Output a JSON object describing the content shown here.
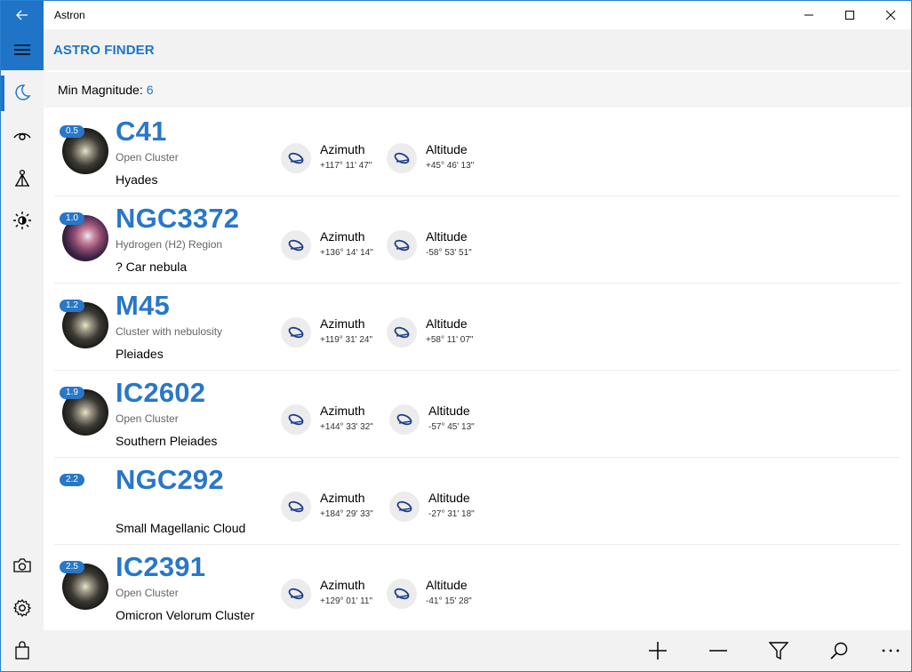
{
  "window": {
    "title": "Astron"
  },
  "header": {
    "title": "ASTRO FINDER"
  },
  "filter": {
    "label": "Min Magnitude:",
    "value": "6"
  },
  "objects": [
    {
      "magnitude": "0.5",
      "designation": "C41",
      "type": "Open Cluster",
      "common_name": "Hyades",
      "thumb": "cluster",
      "azimuth_label": "Azimuth",
      "azimuth": "+117° 11' 47\"",
      "altitude_label": "Altitude",
      "altitude": "+45° 46' 13\""
    },
    {
      "magnitude": "1.0",
      "designation": "NGC3372",
      "type": "Hydrogen (H2) Region",
      "common_name": "? Car nebula",
      "thumb": "nebula",
      "azimuth_label": "Azimuth",
      "azimuth": "+136° 14' 14\"",
      "altitude_label": "Altitude",
      "altitude": "-58° 53' 51\""
    },
    {
      "magnitude": "1.2",
      "designation": "M45",
      "type": "Cluster with nebulosity",
      "common_name": "Pleiades",
      "thumb": "cluster",
      "azimuth_label": "Azimuth",
      "azimuth": "+119° 31' 24\"",
      "altitude_label": "Altitude",
      "altitude": "+58° 11' 07\""
    },
    {
      "magnitude": "1.9",
      "designation": "IC2602",
      "type": "Open Cluster",
      "common_name": "Southern Pleiades",
      "thumb": "cluster",
      "azimuth_label": "Azimuth",
      "azimuth": "+144° 33' 32\"",
      "altitude_label": "Altitude",
      "altitude": "-57° 45' 13\""
    },
    {
      "magnitude": "2.2",
      "designation": "NGC292",
      "type": "",
      "common_name": "Small Magellanic Cloud",
      "thumb": "none",
      "azimuth_label": "Azimuth",
      "azimuth": "+184° 29' 33\"",
      "altitude_label": "Altitude",
      "altitude": "-27° 31' 18\""
    },
    {
      "magnitude": "2.5",
      "designation": "IC2391",
      "type": "Open Cluster",
      "common_name": "Omicron Velorum Cluster",
      "thumb": "cluster",
      "azimuth_label": "Azimuth",
      "azimuth": "+129° 01' 11\"",
      "altitude_label": "Altitude",
      "altitude": "-41° 15' 28\""
    }
  ],
  "rail_icons": [
    "menu-icon",
    "moon-icon",
    "eye-icon",
    "telescope-icon",
    "brightness-icon",
    "camera-icon",
    "settings-icon",
    "store-bag-icon"
  ],
  "bottom_icons": [
    "add-icon",
    "remove-icon",
    "filter-icon",
    "search-icon",
    "more-icon"
  ],
  "colors": {
    "accent": "#1f74c7",
    "designation": "#2877c9",
    "rail_bg": "#f2f2f2"
  }
}
